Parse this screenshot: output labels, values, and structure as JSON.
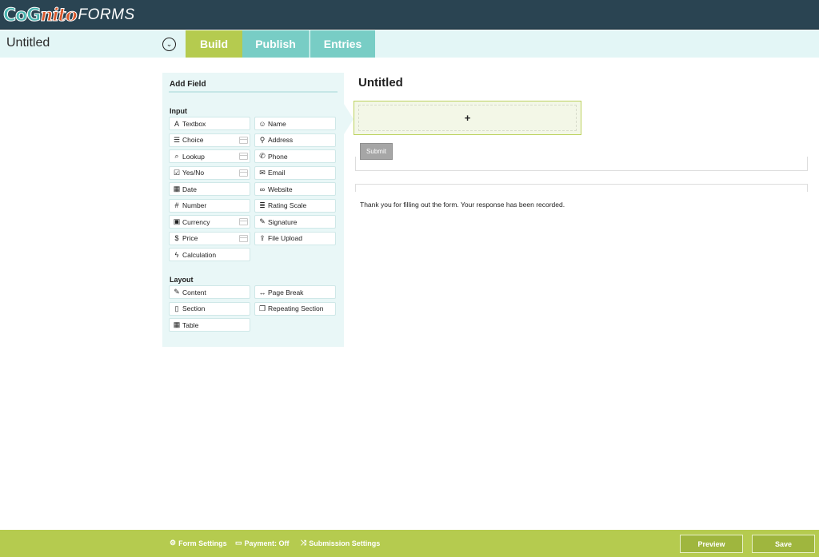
{
  "app": {
    "logo_part1": "CoG",
    "logo_part2": "nito",
    "logo_part3": "FORMS"
  },
  "header": {
    "form_name": "Untitled",
    "dropdown_icon": "chevron-down-circle-icon",
    "tabs": [
      {
        "label": "Build",
        "active": true
      },
      {
        "label": "Publish",
        "active": false
      },
      {
        "label": "Entries",
        "active": false
      }
    ]
  },
  "add_field": {
    "title": "Add Field",
    "input_label": "Input",
    "input_fields": [
      {
        "label": "Textbox",
        "icon": "A",
        "payment": false
      },
      {
        "label": "Name",
        "icon": "☺",
        "payment": false
      },
      {
        "label": "Choice",
        "icon": "☰",
        "payment": true
      },
      {
        "label": "Address",
        "icon": "⚲",
        "payment": false
      },
      {
        "label": "Lookup",
        "icon": "⌕",
        "payment": true
      },
      {
        "label": "Phone",
        "icon": "✆",
        "payment": false
      },
      {
        "label": "Yes/No",
        "icon": "☑",
        "payment": true
      },
      {
        "label": "Email",
        "icon": "✉",
        "payment": false
      },
      {
        "label": "Date",
        "icon": "▦",
        "payment": false
      },
      {
        "label": "Website",
        "icon": "∞",
        "payment": false
      },
      {
        "label": "Number",
        "icon": "#",
        "payment": false
      },
      {
        "label": "Rating Scale",
        "icon": "≣",
        "payment": false
      },
      {
        "label": "Currency",
        "icon": "▣",
        "payment": true
      },
      {
        "label": "Signature",
        "icon": "✎",
        "payment": false
      },
      {
        "label": "Price",
        "icon": "$",
        "payment": true
      },
      {
        "label": "File Upload",
        "icon": "⇪",
        "payment": false
      },
      {
        "label": "Calculation",
        "icon": "ϟ",
        "payment": false
      }
    ],
    "layout_label": "Layout",
    "layout_fields": [
      {
        "label": "Content",
        "icon": "✎"
      },
      {
        "label": "Page Break",
        "icon": "↔"
      },
      {
        "label": "Section",
        "icon": "▯"
      },
      {
        "label": "Repeating Section",
        "icon": "❐"
      },
      {
        "label": "Table",
        "icon": "▦"
      }
    ]
  },
  "form": {
    "title": "Untitled",
    "add_symbol": "+",
    "submit_label": "Submit",
    "confirmation": "Thank you for filling out the form. Your response has been recorded."
  },
  "footer": {
    "form_settings": "Form Settings",
    "payment": "Payment: Off",
    "submission_settings": "Submission Settings",
    "preview": "Preview",
    "save": "Save"
  },
  "colors": {
    "topbar": "#2a4452",
    "accent_green": "#b5cb4f",
    "accent_teal": "#78cdc5",
    "panel_bg": "#e9f7f7"
  }
}
